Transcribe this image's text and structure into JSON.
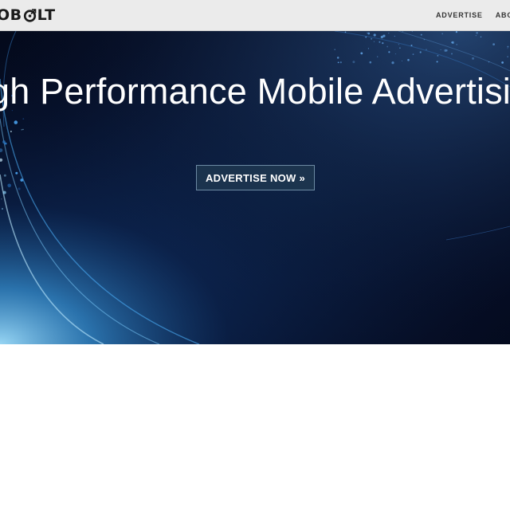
{
  "brand": {
    "logo_prefix": "",
    "logo_text_after": "LT",
    "logo_before": "B",
    "logo_icon": "bolt-target-o-icon"
  },
  "nav": {
    "items": [
      {
        "label": "ADVERTISE"
      },
      {
        "label": "ABOUT"
      }
    ]
  },
  "hero": {
    "title": "gh Performance Mobile Advertising",
    "cta_label": "ADVERTISE NOW »",
    "background_accent": "#2a7fd4"
  },
  "colors": {
    "navbar_bg": "#ebebeb",
    "hero_bg": "#050c22",
    "cta_bg": "#1e3750",
    "cta_border": "#6c8aa3"
  }
}
